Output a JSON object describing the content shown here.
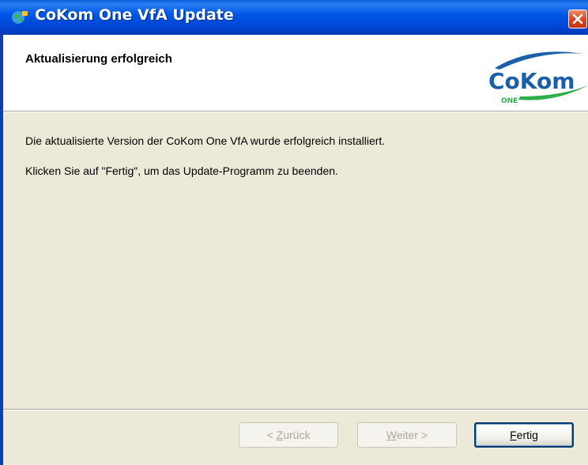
{
  "window": {
    "title": "CoKom One VfA Update"
  },
  "header": {
    "title": "Aktualisierung erfolgreich",
    "logo": {
      "text": "CoKom",
      "sub": "ONE"
    }
  },
  "body": {
    "line1": "Die aktualisierte Version der CoKom One VfA wurde erfolgreich installiert.",
    "line2": "Klicken Sie auf \"Fertig\", um das Update-Programm zu beenden."
  },
  "buttons": {
    "back": {
      "prefix": "< ",
      "mnemonic": "Z",
      "rest": "urück",
      "enabled": false
    },
    "next": {
      "mnemonic": "W",
      "rest": "eiter >",
      "enabled": false
    },
    "finish": {
      "mnemonic": "F",
      "rest": "ertig",
      "enabled": true
    }
  },
  "colors": {
    "titlebar": "#0058e6",
    "logo_blue": "#1a5fa8",
    "logo_green": "#2fae4c",
    "dialog_bg": "#ece9d8"
  }
}
